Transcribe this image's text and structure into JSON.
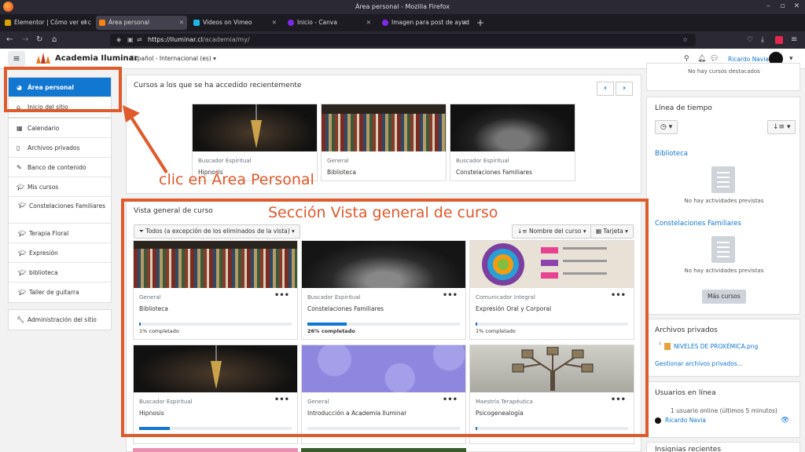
{
  "browser": {
    "window_title": "Área personal - Mozilla Firefox",
    "tabs": [
      {
        "label": "Elementor | Cómo ver el c",
        "active": false
      },
      {
        "label": "Área personal",
        "active": true
      },
      {
        "label": "Videos on Vimeo",
        "active": false
      },
      {
        "label": "Inicio - Canva",
        "active": false
      },
      {
        "label": "Imagen para post de ayud",
        "active": false
      }
    ],
    "url_host": "https://iluminar.cl",
    "url_path": "/academia/my/"
  },
  "header": {
    "site_name": "Academia Iluminar",
    "language": "Español - Internacional (es)",
    "user_name": "Ricardo Navia"
  },
  "drawer": {
    "items": [
      {
        "label": "Área personal",
        "icon": "dashboard-icon"
      },
      {
        "label": "Inicio del sitio",
        "icon": "home-icon"
      }
    ],
    "items2": [
      {
        "label": "Calendario",
        "icon": "calendar-icon"
      },
      {
        "label": "Archivos privados",
        "icon": "file-icon"
      },
      {
        "label": "Banco de contenido",
        "icon": "paintbrush-icon"
      },
      {
        "label": "Mis cursos",
        "icon": "graduation-cap-icon"
      },
      {
        "label": "Constelaciones Familiares",
        "icon": "graduation-cap-icon"
      },
      {
        "label": "Terapia Floral",
        "icon": "graduation-cap-icon"
      },
      {
        "label": "Expresión",
        "icon": "graduation-cap-icon"
      },
      {
        "label": "biblioteca",
        "icon": "graduation-cap-icon"
      },
      {
        "label": "Taller de guitarra",
        "icon": "graduation-cap-icon"
      }
    ],
    "admin": {
      "label": "Administración del sitio",
      "icon": "wrench-icon"
    }
  },
  "recent": {
    "title": "Cursos a los que se ha accedido recientemente",
    "courses": [
      {
        "category": "Buscador Espiritual",
        "name": "Hipnosis"
      },
      {
        "category": "General",
        "name": "Biblioteca"
      },
      {
        "category": "Buscador Espiritual",
        "name": "Constelaciones Familiares"
      }
    ]
  },
  "overview": {
    "title": "Vista general de curso",
    "filter": "Todos (a excepción de los eliminados de la vista)",
    "sort": "Nombre del curso",
    "view": "Tarjeta",
    "courses": [
      {
        "category": "General",
        "name": "Biblioteca",
        "progress_text": "1% completado",
        "progress": 0.01
      },
      {
        "category": "Buscador Espiritual",
        "name": "Constelaciones Familiares",
        "progress_text": "26% completado",
        "progress": 0.26
      },
      {
        "category": "Comunicador Integral",
        "name": "Expresión Oral y Corporal",
        "progress_text": "1% completado",
        "progress": 0.01
      },
      {
        "category": "Buscador Espiritual",
        "name": "Hipnosis",
        "progress": 0.2
      },
      {
        "category": "General",
        "name": "Introducción a Academia Iluminar",
        "progress": 0
      },
      {
        "category": "Maestría Terapéutica",
        "name": "Psicogenealogía",
        "progress": 0.01
      }
    ]
  },
  "right": {
    "featured_empty": "No hay cursos destacados",
    "timeline_title": "Línea de tiempo",
    "tl_courses": [
      {
        "name": "Biblioteca",
        "empty": "No hay actividades previstas"
      },
      {
        "name": "Constelaciones Familiares",
        "empty": "No hay actividades previstas"
      }
    ],
    "more_courses": "Más cursos",
    "private_files_title": "Archivos privados",
    "file_name": "NIVELES DE PROXÉMICA.png",
    "manage_files": "Gestionar archivos privados...",
    "online_title": "Usuarios en línea",
    "online_count": "1 usuario online (últimos 5 minutos)",
    "online_user": "Ricardo Navia",
    "badges_title": "Insignias recientes"
  },
  "annotations": {
    "click_label": "clic en Área Personal",
    "section_label": "Sección Vista general de curso",
    "color": "#e05a2b"
  }
}
